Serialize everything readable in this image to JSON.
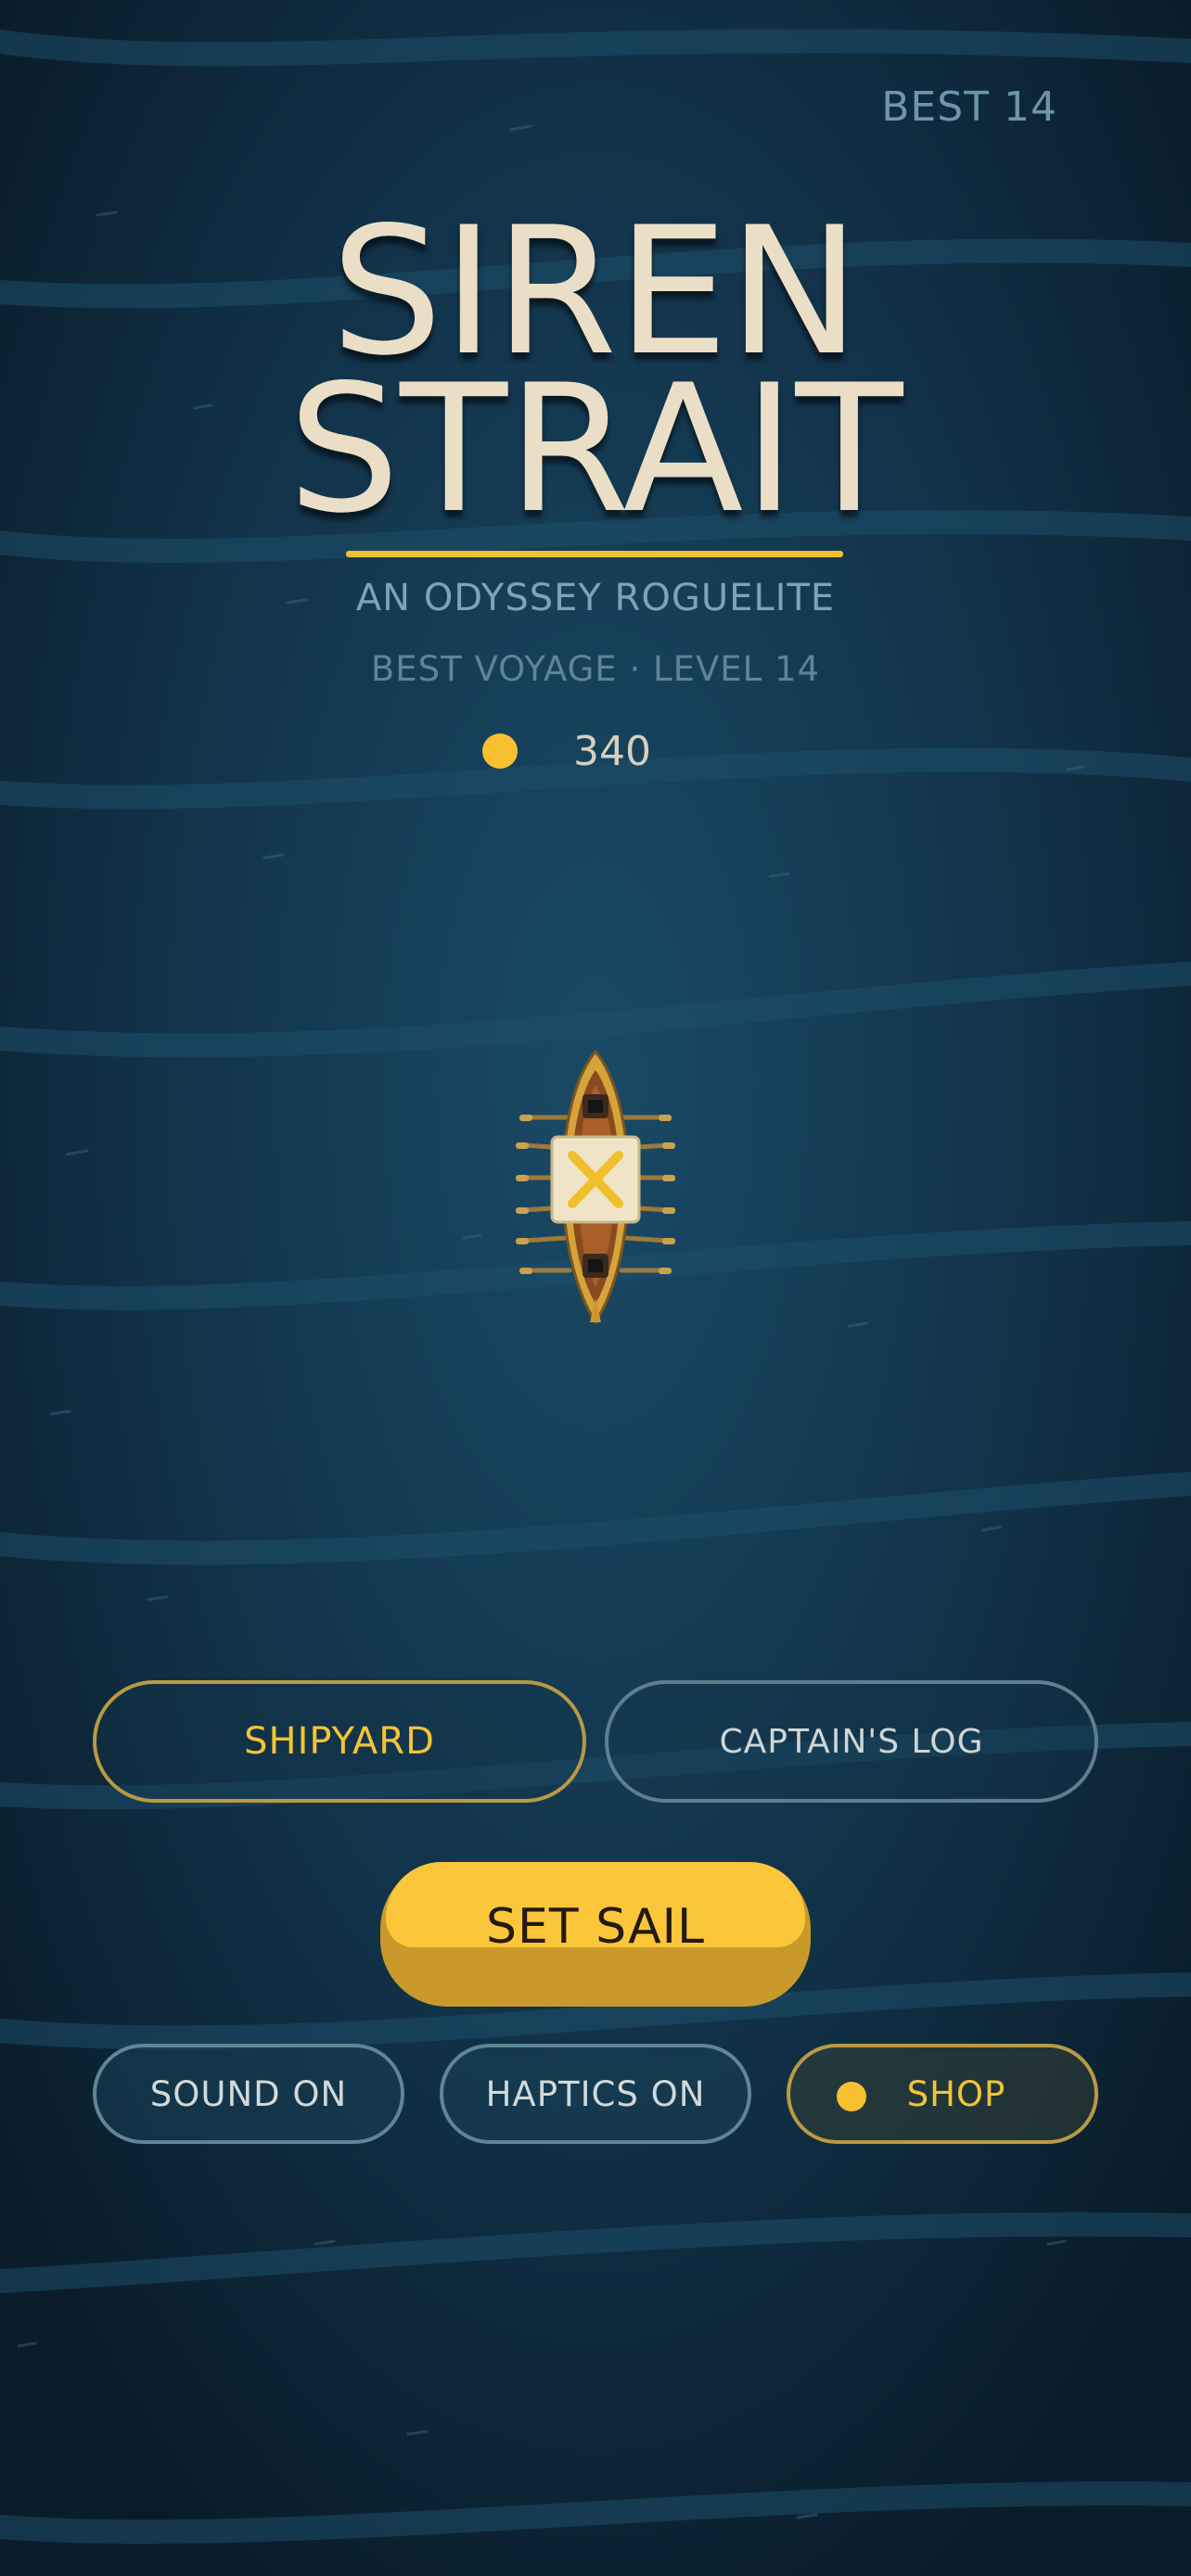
{
  "header": {
    "best_label": "BEST 14"
  },
  "title": {
    "line1": "SIREN",
    "line2": "STRAIT",
    "subtitle": "AN ODYSSEY ROGUELITE"
  },
  "stats": {
    "best_voyage": "BEST VOYAGE · LEVEL 14",
    "coins": "340"
  },
  "menu": {
    "shipyard": "SHIPYARD",
    "captains_log": "CAPTAIN'S LOG",
    "set_sail": "SET SAIL",
    "sound": "SOUND ON",
    "haptics": "HAPTICS ON",
    "shop": "SHOP"
  },
  "icons": {
    "coin": "coin-icon",
    "boat": "ship-icon",
    "shop": "coin-icon"
  },
  "colors": {
    "background": "#0f2a3b",
    "accent_gold": "#f7c031",
    "title_cream": "#eadfc6",
    "muted_blue": "#7fa2b6"
  }
}
